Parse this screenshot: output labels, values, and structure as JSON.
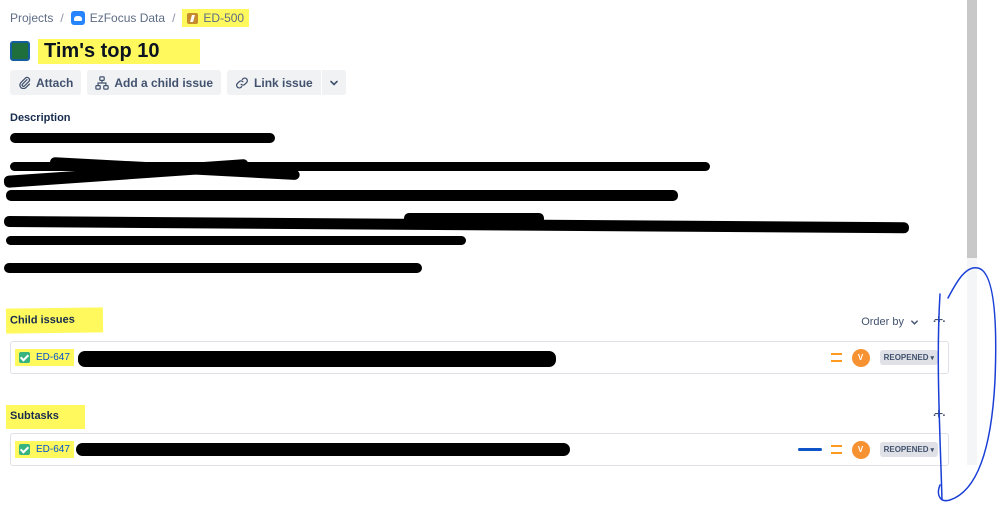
{
  "breadcrumb": {
    "projects": "Projects",
    "separator": "/",
    "project": "EzFocus Data",
    "issue_key": "ED-500"
  },
  "issue": {
    "title": "Tim's top 10"
  },
  "toolbar": {
    "attach": "Attach",
    "add_child": "Add a child issue",
    "link_issue": "Link issue"
  },
  "description": {
    "heading": "Description"
  },
  "child_issues": {
    "heading": "Child issues",
    "order_by": "Order by",
    "items": [
      {
        "key": "ED-647",
        "avatar": "V",
        "status": "REOPENED"
      }
    ]
  },
  "subtasks": {
    "heading": "Subtasks",
    "items": [
      {
        "key": "ED-647",
        "avatar": "V",
        "status": "REOPENED"
      }
    ]
  },
  "colors": {
    "highlight": "#fff95e",
    "link": "#0052cc",
    "priority": "#ff991f",
    "done": "#36b37e",
    "pen": "#1a3fd6"
  }
}
